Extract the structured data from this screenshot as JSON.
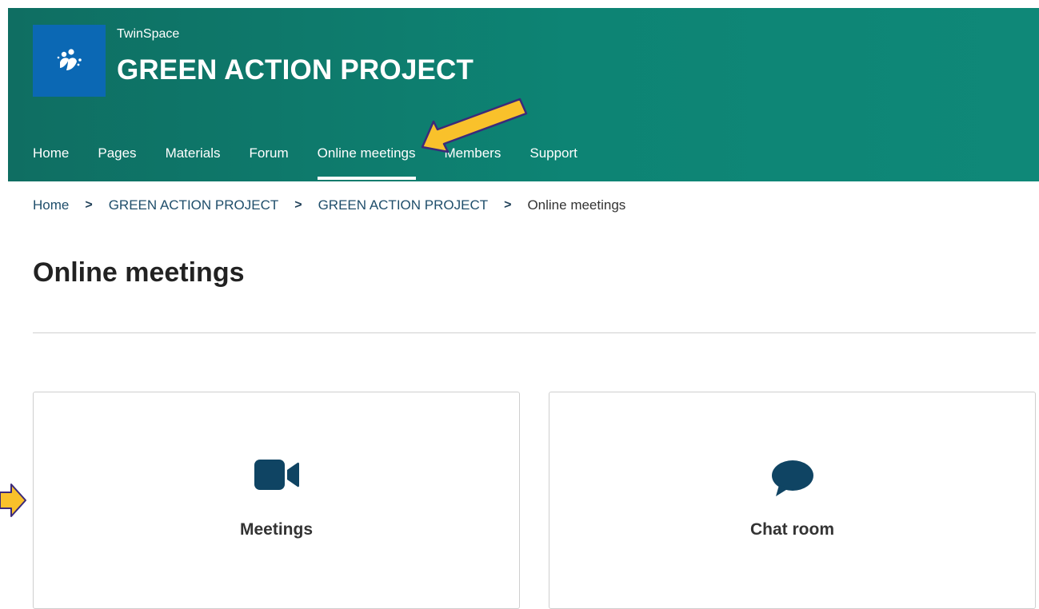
{
  "header": {
    "subtitle": "TwinSpace",
    "title": "GREEN ACTION PROJECT",
    "logo_icon": "etwinning-logo-icon"
  },
  "nav": {
    "items": [
      {
        "label": "Home"
      },
      {
        "label": "Pages"
      },
      {
        "label": "Materials"
      },
      {
        "label": "Forum"
      },
      {
        "label": "Online meetings",
        "active": true
      },
      {
        "label": "Members"
      },
      {
        "label": "Support"
      }
    ]
  },
  "breadcrumb": {
    "items": [
      "Home",
      "GREEN ACTION PROJECT",
      "GREEN ACTION PROJECT"
    ],
    "separator": ">",
    "current": "Online meetings"
  },
  "page": {
    "title": "Online meetings"
  },
  "cards": [
    {
      "label": "Meetings",
      "icon": "video-camera-icon"
    },
    {
      "label": "Chat room",
      "icon": "chat-bubble-icon"
    }
  ],
  "colors": {
    "header_bg": "#0d8474",
    "logo_bg": "#0b68b4",
    "icon": "#0f4463",
    "annotation_arrow": "#f9c12b"
  }
}
